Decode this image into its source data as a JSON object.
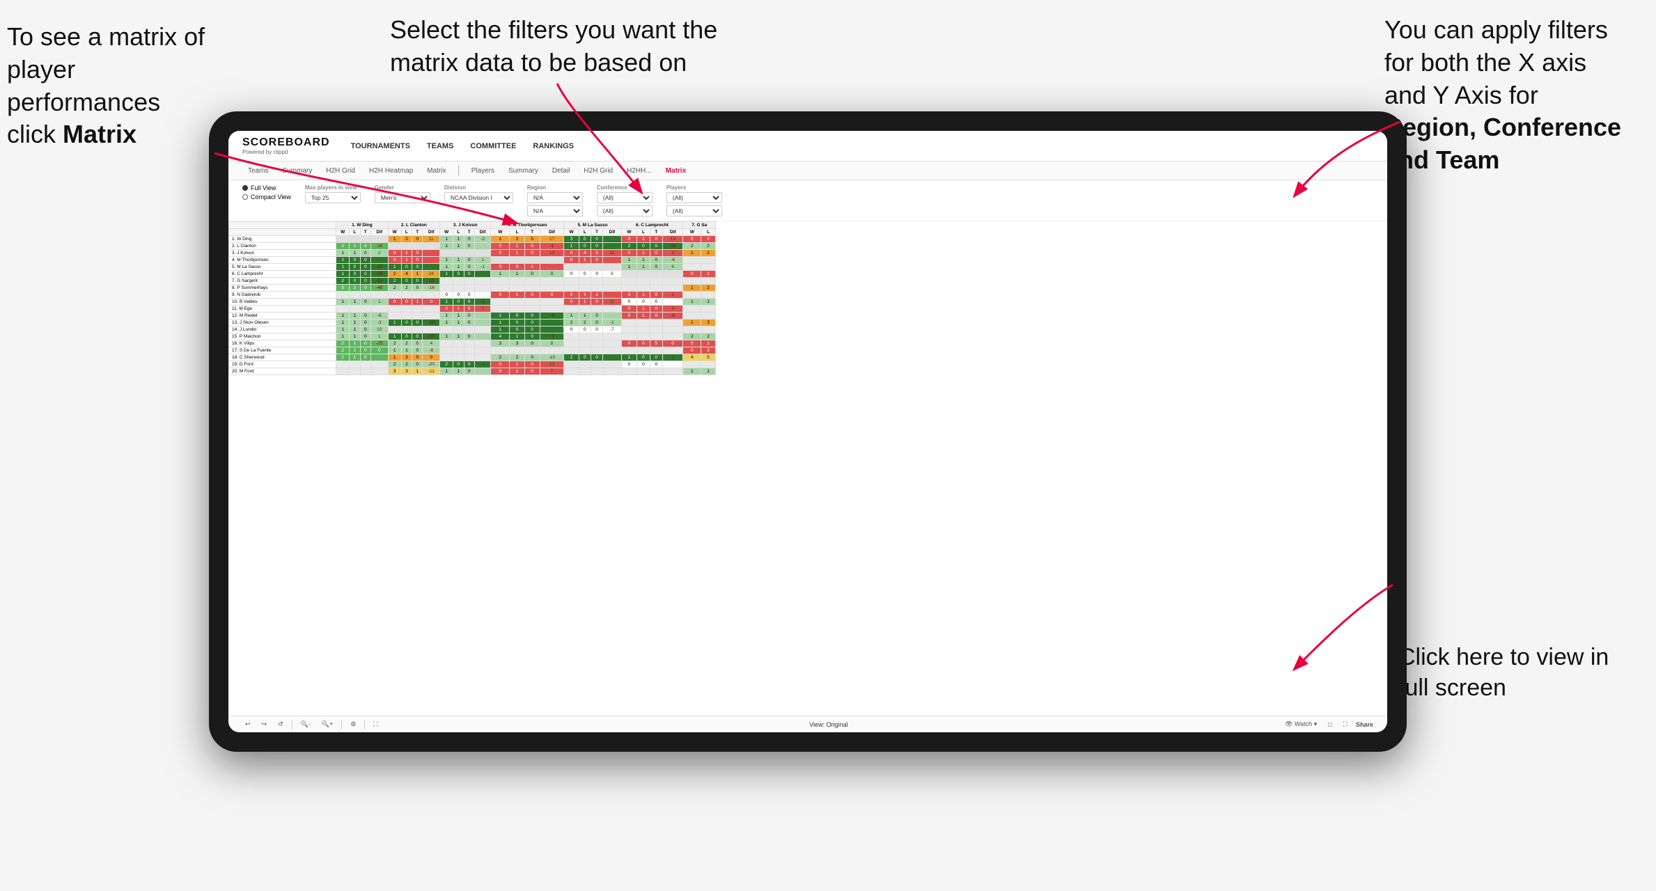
{
  "annotations": {
    "top_left": {
      "line1": "To see a matrix of",
      "line2": "player performances",
      "line3": "click ",
      "line3_bold": "Matrix"
    },
    "top_center": {
      "text": "Select the filters you want the matrix data to be based on"
    },
    "top_right": {
      "line1": "You  can apply filters for both the X axis and Y Axis for ",
      "bold1": "Region, Conference and Team"
    },
    "bottom_right": {
      "line1": "Click here to view in full screen"
    }
  },
  "app": {
    "logo": "SCOREBOARD",
    "logo_sub": "Powered by clippd",
    "nav": [
      "TOURNAMENTS",
      "TEAMS",
      "COMMITTEE",
      "RANKINGS"
    ],
    "sub_nav": [
      "Teams",
      "Summary",
      "H2H Grid",
      "H2H Heatmap",
      "Matrix",
      "Players",
      "Summary",
      "Detail",
      "H2H Grid",
      "H2HH...",
      "Matrix"
    ],
    "active_tab": "Matrix"
  },
  "filters": {
    "view_options": [
      "Full View",
      "Compact View"
    ],
    "selected_view": "Full View",
    "max_players_label": "Max players in view",
    "max_players_value": "Top 25",
    "gender_label": "Gender",
    "gender_value": "Men's",
    "division_label": "Division",
    "division_value": "NCAA Division I",
    "region_label": "Region",
    "region_value": "N/A",
    "conference_label": "Conference",
    "conference_values": [
      "(All)",
      "(All)"
    ],
    "players_label": "Players",
    "players_values": [
      "(All)",
      "(All)"
    ]
  },
  "matrix": {
    "col_headers": [
      "1. W Ding",
      "2. L Clanton",
      "3. J Koivun",
      "4. M Thorbjornsen",
      "5. M La Sasso",
      "6. C Lamprecht",
      "7. G Sa"
    ],
    "sub_headers": [
      "W",
      "L",
      "T",
      "Dif"
    ],
    "rows": [
      {
        "name": "1. W Ding",
        "data": [
          null,
          "1|2|0|11",
          "1|1|0|-2",
          "1|2|0|17",
          "3|0|0|",
          "0|1|0|13",
          "0|2"
        ]
      },
      {
        "name": "2. L Clanton",
        "data": [
          "2|1|0|-16",
          null,
          "1|1|0|",
          "0|1|0|-1",
          "1|0|0|",
          "2|0|0|-24",
          "2|2"
        ]
      },
      {
        "name": "3. J Koivun",
        "data": [
          "1|1|0|2",
          "0|1|0|",
          null,
          "0|1|0|13",
          "0|4|0|11",
          "0|1|0|3",
          "1|2"
        ]
      },
      {
        "name": "4. M Thorbjornsen",
        "data": [
          "1|0|0|",
          "0|1|0|",
          "1|1|0|1",
          null,
          "0|1|0|",
          "1|1|0|-6",
          ""
        ]
      },
      {
        "name": "5. M La Sasso",
        "data": [
          "1|0|0|-15",
          "1|0|0|",
          "1|1|0|-1",
          "0|0|1|",
          null,
          "1|1|0|6",
          ""
        ]
      },
      {
        "name": "6. C Lamprecht",
        "data": [
          "1|0|0|-16",
          "2|4|1|24",
          "1|0|0|",
          "1|1|0|0",
          "0|0|0|6",
          null,
          "0|1"
        ]
      },
      {
        "name": "7. G Sargent",
        "data": [
          "2|0|0|-15",
          "2|0|0|-16",
          "",
          "",
          "",
          "",
          ""
        ]
      },
      {
        "name": "8. P Summerhays",
        "data": [
          "5|2|0|-48",
          "2|2|0|-16",
          "",
          "",
          "",
          "",
          "1|2"
        ]
      },
      {
        "name": "9. N Gabrelcik",
        "data": [
          "",
          "",
          "0|0|0|",
          "0|1|0|0",
          "0|1|1|",
          "0|1|0|1",
          ""
        ]
      },
      {
        "name": "10. B Valdes",
        "data": [
          "1|1|0|1",
          "0|0|1|0",
          "1|0|0|-1",
          "",
          "0|1|0|11",
          "0|0|0|",
          "1|1"
        ]
      },
      {
        "name": "11. M Ege",
        "data": [
          "",
          "",
          "0|1|0|1",
          "",
          "",
          "0|1|0|4",
          ""
        ]
      },
      {
        "name": "12. M Riedel",
        "data": [
          "1|1|0|-6",
          "",
          "1|1|0|",
          "1|0|0|-4",
          "1|1|0|",
          "0|1|0|-6",
          ""
        ]
      },
      {
        "name": "13. J Skov Olesen",
        "data": [
          "1|1|0|-3",
          "1|0|0|-19",
          "1|1|0|",
          "1|0|0|",
          "2|2|0|-1",
          "",
          "1|3"
        ]
      },
      {
        "name": "14. J Lundin",
        "data": [
          "1|1|0|10",
          "",
          "",
          "1|0|0|",
          "0|0|0|-7",
          "",
          ""
        ]
      },
      {
        "name": "15. P Maichon",
        "data": [
          "1|1|0|1",
          "1|0|0|-19",
          "1|1|0|",
          "4|1|0|-7",
          "",
          "",
          "2|2"
        ]
      },
      {
        "name": "16. K Vilips",
        "data": [
          "2|1|0|-25",
          "2|2|0|4",
          "",
          "3|3|0|8",
          "",
          "0|0|5|0",
          "0|1"
        ]
      },
      {
        "name": "17. S De La Fuente",
        "data": [
          "2|1|0|0",
          "1|1|0|-8",
          "",
          "",
          "",
          "",
          "0|2"
        ]
      },
      {
        "name": "18. C Sherwood",
        "data": [
          "2|1|0|",
          "1|3|0|0",
          "",
          "2|2|0|-10",
          "2|0|0|",
          "1|0|0|3|1|1",
          "4|5"
        ]
      },
      {
        "name": "19. D Ford",
        "data": [
          "",
          "2|2|0|-20",
          "2|0|0|-1",
          "0|1|0|13",
          "",
          "0|0|0|",
          ""
        ]
      },
      {
        "name": "20. M Ford",
        "data": [
          "",
          "3|3|1|-11",
          "1|1|0|",
          "0|1|0|7",
          "",
          "",
          "1|1"
        ]
      }
    ]
  },
  "toolbar": {
    "view_label": "View: Original",
    "watch_label": "Watch",
    "share_label": "Share"
  },
  "colors": {
    "accent": "#e8003d",
    "green_dark": "#2d7a2d",
    "green": "#5cb85c",
    "yellow": "#f0d060",
    "orange": "#f0a030",
    "red": "#e05050"
  }
}
